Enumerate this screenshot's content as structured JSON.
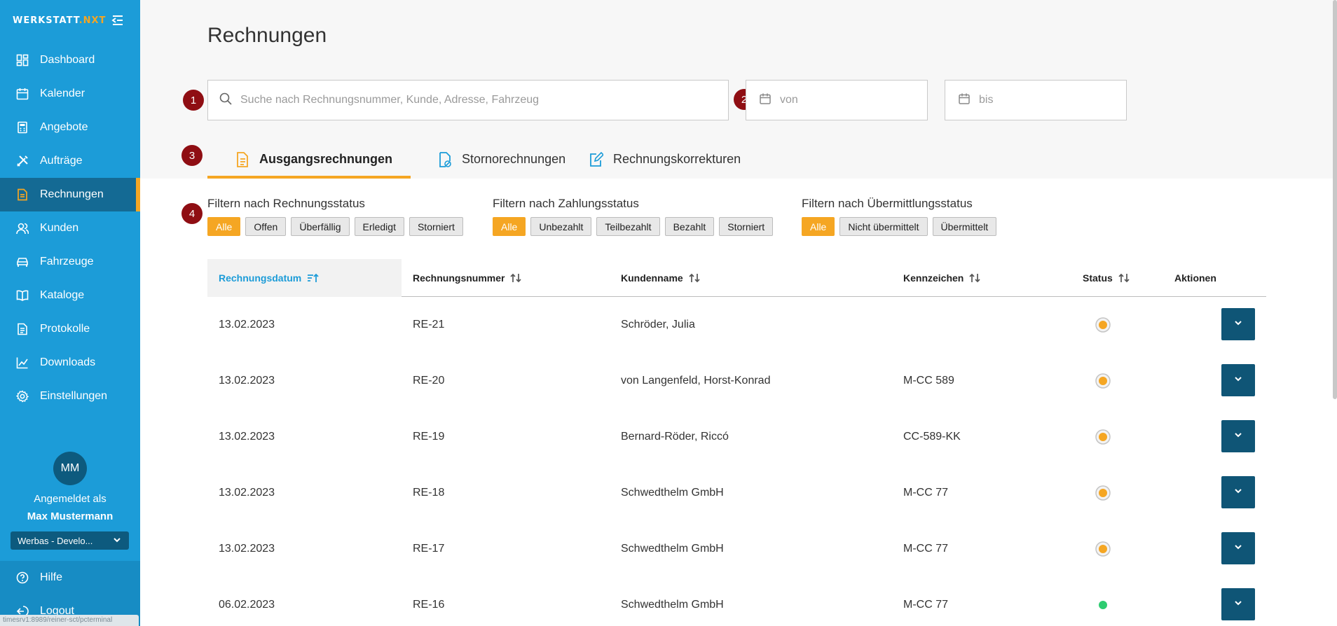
{
  "brand": {
    "name_main": "WERKSTATT",
    "name_accent": ".NXT"
  },
  "colors": {
    "sidebar": "#1c9cd8",
    "active": "#146a94",
    "accent": "#f5a623",
    "action": "#0f5576",
    "badge": "#8f0e13"
  },
  "sidebar": {
    "items": [
      {
        "label": "Dashboard",
        "icon": "dashboard-icon"
      },
      {
        "label": "Kalender",
        "icon": "calendar-icon"
      },
      {
        "label": "Angebote",
        "icon": "calculator-icon"
      },
      {
        "label": "Aufträge",
        "icon": "tools-icon"
      },
      {
        "label": "Rechnungen",
        "icon": "document-icon",
        "active": true
      },
      {
        "label": "Kunden",
        "icon": "users-icon"
      },
      {
        "label": "Fahrzeuge",
        "icon": "car-icon"
      },
      {
        "label": "Kataloge",
        "icon": "book-icon"
      },
      {
        "label": "Protokolle",
        "icon": "protocol-icon"
      },
      {
        "label": "Downloads",
        "icon": "chart-line-icon"
      },
      {
        "label": "Einstellungen",
        "icon": "gear-icon"
      }
    ],
    "avatar_initials": "MM",
    "logged_in_as": "Angemeldet als",
    "user_name": "Max Mustermann",
    "tenant": "Werbas - Develo...",
    "help": "Hilfe",
    "logout": "Logout",
    "status_url": "timesrv1:8989/reiner-sct/pcterminal"
  },
  "page": {
    "title": "Rechnungen"
  },
  "badges": [
    "1",
    "2",
    "3",
    "4"
  ],
  "search": {
    "placeholder": "Suche nach Rechnungsnummer, Kunde, Adresse, Fahrzeug",
    "value": ""
  },
  "date_from": {
    "placeholder": "von"
  },
  "date_to": {
    "placeholder": "bis"
  },
  "tabs": [
    {
      "label": "Ausgangsrechnungen",
      "active": true
    },
    {
      "label": "Stornorechnungen"
    },
    {
      "label": "Rechnungskorrekturen"
    }
  ],
  "filters": [
    {
      "title": "Filtern nach Rechnungsstatus",
      "options": [
        "Alle",
        "Offen",
        "Überfällig",
        "Erledigt",
        "Storniert"
      ],
      "selected": "Alle"
    },
    {
      "title": "Filtern nach Zahlungsstatus",
      "options": [
        "Alle",
        "Unbezahlt",
        "Teilbezahlt",
        "Bezahlt",
        "Storniert"
      ],
      "selected": "Alle"
    },
    {
      "title": "Filtern nach Übermittlungsstatus",
      "options": [
        "Alle",
        "Nicht übermittelt",
        "Übermittelt"
      ],
      "selected": "Alle"
    }
  ],
  "table": {
    "columns": [
      "Rechnungsdatum",
      "Rechnungsnummer",
      "Kundenname",
      "Kennzeichen",
      "Status",
      "Aktionen"
    ],
    "rows": [
      {
        "date": "13.02.2023",
        "number": "RE-21",
        "customer": "Schröder, Julia",
        "plate": "",
        "status": "open"
      },
      {
        "date": "13.02.2023",
        "number": "RE-20",
        "customer": "von Langenfeld, Horst-Konrad",
        "plate": "M-CC 589",
        "status": "open"
      },
      {
        "date": "13.02.2023",
        "number": "RE-19",
        "customer": "Bernard-Röder, Riccó",
        "plate": "CC-589-KK",
        "status": "open"
      },
      {
        "date": "13.02.2023",
        "number": "RE-18",
        "customer": "Schwedthelm GmbH",
        "plate": "M-CC 77",
        "status": "open"
      },
      {
        "date": "13.02.2023",
        "number": "RE-17",
        "customer": "Schwedthelm GmbH",
        "plate": "M-CC 77",
        "status": "open"
      },
      {
        "date": "06.02.2023",
        "number": "RE-16",
        "customer": "Schwedthelm GmbH",
        "plate": "M-CC 77",
        "status": "done"
      }
    ]
  }
}
